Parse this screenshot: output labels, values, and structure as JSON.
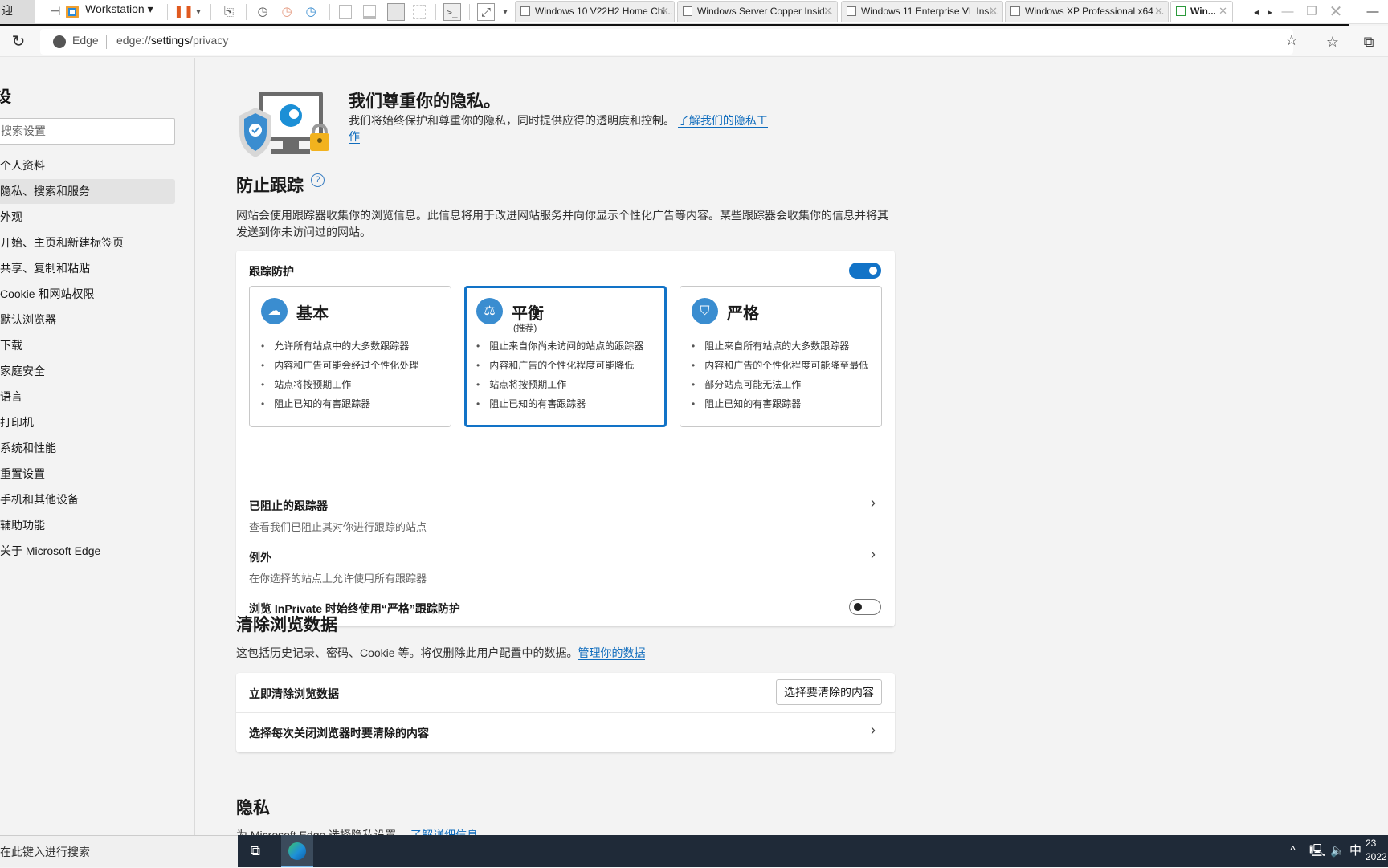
{
  "vm_toolbar": {
    "left_stub_text": "迎",
    "title": "Workstation",
    "tabs": [
      {
        "label": "Windows 10 V22H2 Home Chi...",
        "active": false
      },
      {
        "label": "Windows Server Copper Insid...",
        "active": false
      },
      {
        "label": "Windows 11 Enterprise VL Insi...",
        "active": false
      },
      {
        "label": "Windows XP Professional x64 ...",
        "active": false
      },
      {
        "label": "Win...",
        "active": true
      }
    ],
    "icons": {
      "pin": "⊣",
      "pause": "❚❚",
      "dropdown": "▾",
      "send_keys": "⎘",
      "snapshot": "◷",
      "revert": "◷",
      "manage": "◷",
      "console": ">_",
      "fullscreen": "⤢",
      "scroll_left": "◂",
      "scroll_right": "▸",
      "minimize": "—",
      "restore": "❐",
      "close": "✕",
      "tab_close": "✕"
    }
  },
  "browser": {
    "refresh_icon": "↻",
    "site_label": "Edge",
    "url_prefix": "edge://",
    "url_bold": "settings",
    "url_suffix": "/privacy",
    "icons": {
      "favorite_add": "☆",
      "favorites": "☆",
      "collections": "⧉"
    }
  },
  "sidebar": {
    "heading": "设",
    "search_placeholder": "搜索设置",
    "items": [
      {
        "label": "个人资料",
        "active": false
      },
      {
        "label": "隐私、搜索和服务",
        "active": true
      },
      {
        "label": "外观",
        "active": false
      },
      {
        "label": "开始、主页和新建标签页",
        "active": false
      },
      {
        "label": "共享、复制和粘贴",
        "active": false
      },
      {
        "label": "Cookie 和网站权限",
        "active": false
      },
      {
        "label": "默认浏览器",
        "active": false
      },
      {
        "label": "下载",
        "active": false
      },
      {
        "label": "家庭安全",
        "active": false
      },
      {
        "label": "语言",
        "active": false
      },
      {
        "label": "打印机",
        "active": false
      },
      {
        "label": "系统和性能",
        "active": false
      },
      {
        "label": "重置设置",
        "active": false
      },
      {
        "label": "手机和其他设备",
        "active": false
      },
      {
        "label": "辅助功能",
        "active": false
      },
      {
        "label": "关于 Microsoft Edge",
        "active": false
      }
    ]
  },
  "hero": {
    "title": "我们尊重你的隐私。",
    "description": "我们将始终保护和尊重你的隐私，同时提供应得的透明度和控制。",
    "link": "了解我们的隐私工作"
  },
  "tracking": {
    "heading": "防止跟踪",
    "help_icon": "?",
    "description": "网站会使用跟踪器收集你的浏览信息。此信息将用于改进网站服务并向你显示个性化广告等内容。某些跟踪器会收集你的信息并将其发送到你未访问过的网站。",
    "protection_label": "跟踪防护",
    "protection_enabled": true,
    "modes": [
      {
        "title": "基本",
        "subtitle": "",
        "selected": false,
        "icon": "☁",
        "bullets": [
          "允许所有站点中的大多数跟踪器",
          "内容和广告可能会经过个性化处理",
          "站点将按预期工作",
          "阻止已知的有害跟踪器"
        ]
      },
      {
        "title": "平衡",
        "subtitle": "(推荐)",
        "selected": true,
        "icon": "⚖",
        "bullets": [
          "阻止来自你尚未访问的站点的跟踪器",
          "内容和广告的个性化程度可能降低",
          "站点将按预期工作",
          "阻止已知的有害跟踪器"
        ]
      },
      {
        "title": "严格",
        "subtitle": "",
        "selected": false,
        "icon": "⛉",
        "bullets": [
          "阻止来自所有站点的大多数跟踪器",
          "内容和广告的个性化程度可能降至最低",
          "部分站点可能无法工作",
          "阻止已知的有害跟踪器"
        ]
      }
    ],
    "blocked_label": "已阻止的跟踪器",
    "blocked_sub": "查看我们已阻止其对你进行跟踪的站点",
    "exceptions_label": "例外",
    "exceptions_sub": "在你选择的站点上允许使用所有跟踪器",
    "inprivate_label": "浏览 InPrivate 时始终使用“严格”跟踪防护",
    "inprivate_enabled": false,
    "chevron": "›"
  },
  "clear_data": {
    "heading": "清除浏览数据",
    "description": "这包括历史记录、密码、Cookie 等。将仅删除此用户配置中的数据。",
    "link": "管理你的数据",
    "clear_now_label": "立即清除浏览数据",
    "clear_button": "选择要清除的内容",
    "on_close_label": "选择每次关闭浏览器时要清除的内容",
    "chevron": "›"
  },
  "privacy": {
    "heading": "隐私",
    "description": "为 Microsoft Edge 选择隐私设置。",
    "link": "了解详细信息"
  },
  "taskbar": {
    "search_placeholder": "在此键入进行搜索",
    "taskview_icon": "⧉",
    "tray": {
      "chevron": "^",
      "network": "🖳",
      "volume": "🔈",
      "ime": "中"
    },
    "clock_time": "23",
    "clock_date": "2022"
  }
}
